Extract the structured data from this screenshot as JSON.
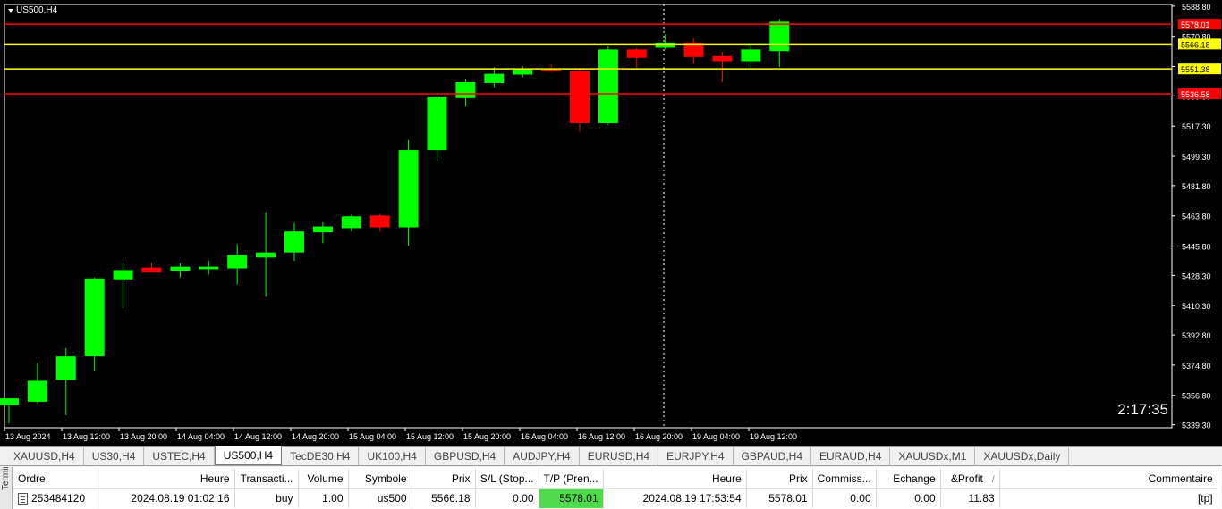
{
  "chart": {
    "symbol": "US500,H4",
    "countdown": "2:17:35",
    "bull_color": "#00ff00",
    "bear_color": "#ff0000",
    "background": "#000000",
    "price_axis": {
      "ticks": [
        "5588.80",
        "5570.80",
        "5552.80",
        "5535.30",
        "5517.30",
        "5499.30",
        "5481.80",
        "5463.80",
        "5445.80",
        "5428.30",
        "5410.30",
        "5392.80",
        "5374.80",
        "5356.80",
        "5339.30"
      ]
    },
    "time_axis": {
      "labels": [
        "13 Aug 2024",
        "13 Aug 12:00",
        "13 Aug 20:00",
        "14 Aug 04:00",
        "14 Aug 12:00",
        "14 Aug 20:00",
        "15 Aug 04:00",
        "15 Aug 12:00",
        "15 Aug 20:00",
        "16 Aug 04:00",
        "16 Aug 12:00",
        "16 Aug 20:00",
        "19 Aug 04:00",
        "19 Aug 12:00"
      ]
    },
    "levels": [
      {
        "name": "tp-line",
        "price": 5578.01,
        "label": "5578.01",
        "color": "#ff0000"
      },
      {
        "name": "open-price-line",
        "price": 5566.18,
        "label": "5566.18",
        "color": "#ffff00"
      },
      {
        "name": "yellow-level-line",
        "price": 5551.38,
        "label": "5551.38",
        "color": "#ffff00"
      },
      {
        "name": "sl-line",
        "price": 5536.58,
        "label": "5536.58",
        "color": "#ff0000"
      }
    ]
  },
  "chart_data": {
    "type": "candlestick",
    "title": "US500,H4",
    "ylim": [
      5335,
      5592
    ],
    "candles": [
      {
        "o": 5351.0,
        "h": 5354.5,
        "l": 5340.0,
        "c": 5355.0
      },
      {
        "o": 5353.0,
        "h": 5376.0,
        "l": 5352.0,
        "c": 5365.5
      },
      {
        "o": 5366.0,
        "h": 5385.0,
        "l": 5345.0,
        "c": 5380.0
      },
      {
        "o": 5380.0,
        "h": 5427.0,
        "l": 5371.0,
        "c": 5426.5
      },
      {
        "o": 5426.0,
        "h": 5436.0,
        "l": 5409.0,
        "c": 5431.5
      },
      {
        "o": 5433.0,
        "h": 5436.0,
        "l": 5430.5,
        "c": 5430.0
      },
      {
        "o": 5431.0,
        "h": 5435.5,
        "l": 5427.0,
        "c": 5433.5
      },
      {
        "o": 5432.0,
        "h": 5437.0,
        "l": 5429.0,
        "c": 5433.5
      },
      {
        "o": 5432.5,
        "h": 5447.0,
        "l": 5423.0,
        "c": 5440.5
      },
      {
        "o": 5439.0,
        "h": 5466.0,
        "l": 5415.5,
        "c": 5442.0
      },
      {
        "o": 5442.0,
        "h": 5459.5,
        "l": 5437.0,
        "c": 5454.5
      },
      {
        "o": 5454.0,
        "h": 5460.0,
        "l": 5447.5,
        "c": 5457.5
      },
      {
        "o": 5456.5,
        "h": 5464.5,
        "l": 5454.5,
        "c": 5463.5
      },
      {
        "o": 5464.0,
        "h": 5465.0,
        "l": 5454.5,
        "c": 5457.0
      },
      {
        "o": 5457.0,
        "h": 5509.0,
        "l": 5446.0,
        "c": 5503.0
      },
      {
        "o": 5503.0,
        "h": 5536.5,
        "l": 5496.5,
        "c": 5534.5
      },
      {
        "o": 5534.0,
        "h": 5545.5,
        "l": 5529.0,
        "c": 5543.5
      },
      {
        "o": 5543.0,
        "h": 5552.5,
        "l": 5540.5,
        "c": 5548.5
      },
      {
        "o": 5548.0,
        "h": 5553.0,
        "l": 5546.5,
        "c": 5551.5
      },
      {
        "o": 5551.0,
        "h": 5554.0,
        "l": 5549.5,
        "c": 5550.0
      },
      {
        "o": 5550.0,
        "h": 5551.5,
        "l": 5514.0,
        "c": 5519.0
      },
      {
        "o": 5519.0,
        "h": 5565.0,
        "l": 5518.0,
        "c": 5563.0
      },
      {
        "o": 5563.0,
        "h": 5564.0,
        "l": 5552.0,
        "c": 5558.0
      },
      {
        "o": 5564.0,
        "h": 5572.0,
        "l": 5563.0,
        "c": 5567.0
      },
      {
        "o": 5567.0,
        "h": 5569.5,
        "l": 5554.5,
        "c": 5558.5
      },
      {
        "o": 5559.0,
        "h": 5561.5,
        "l": 5543.5,
        "c": 5556.0
      },
      {
        "o": 5556.0,
        "h": 5566.5,
        "l": 5551.0,
        "c": 5563.0
      },
      {
        "o": 5562.0,
        "h": 5581.0,
        "l": 5552.5,
        "c": 5579.5
      }
    ]
  },
  "tabs": [
    {
      "label": "XAUUSD,H4",
      "active": false
    },
    {
      "label": "US30,H4",
      "active": false
    },
    {
      "label": "USTEC,H4",
      "active": false
    },
    {
      "label": "US500,H4",
      "active": true
    },
    {
      "label": "TecDE30,H4",
      "active": false
    },
    {
      "label": "UK100,H4",
      "active": false
    },
    {
      "label": "GBPUSD,H4",
      "active": false
    },
    {
      "label": "AUDJPY,H4",
      "active": false
    },
    {
      "label": "EURUSD,H4",
      "active": false
    },
    {
      "label": "EURJPY,H4",
      "active": false
    },
    {
      "label": "GBPAUD,H4",
      "active": false
    },
    {
      "label": "EURAUD,H4",
      "active": false
    },
    {
      "label": "XAUUSDx,M1",
      "active": false
    },
    {
      "label": "XAUUSDx,Daily",
      "active": false
    }
  ],
  "terminal": {
    "side_label": "Terminal",
    "columns": {
      "order": "Ordre",
      "open_time": "Heure",
      "type": "Transacti...",
      "volume": "Volume",
      "symbol": "Symbole",
      "open_price": "Prix",
      "sl": "S/L (Stop...",
      "tp": "T/P (Pren...",
      "close_time": "Heure",
      "close_price": "Prix",
      "commission": "Commiss...",
      "swap": "Echange",
      "profit": "&Profit",
      "comment": "Commentaire"
    },
    "sort_indicator": "/",
    "rows": [
      {
        "order": "253484120",
        "open_time": "2024.08.19 01:02:16",
        "type": "buy",
        "volume": "1.00",
        "symbol": "us500",
        "open_price": "5566.18",
        "sl": "0.00",
        "tp": "5578.01",
        "close_time": "2024.08.19 17:53:54",
        "close_price": "5578.01",
        "commission": "0.00",
        "swap": "0.00",
        "profit": "11.83",
        "comment": "[tp]"
      }
    ]
  }
}
